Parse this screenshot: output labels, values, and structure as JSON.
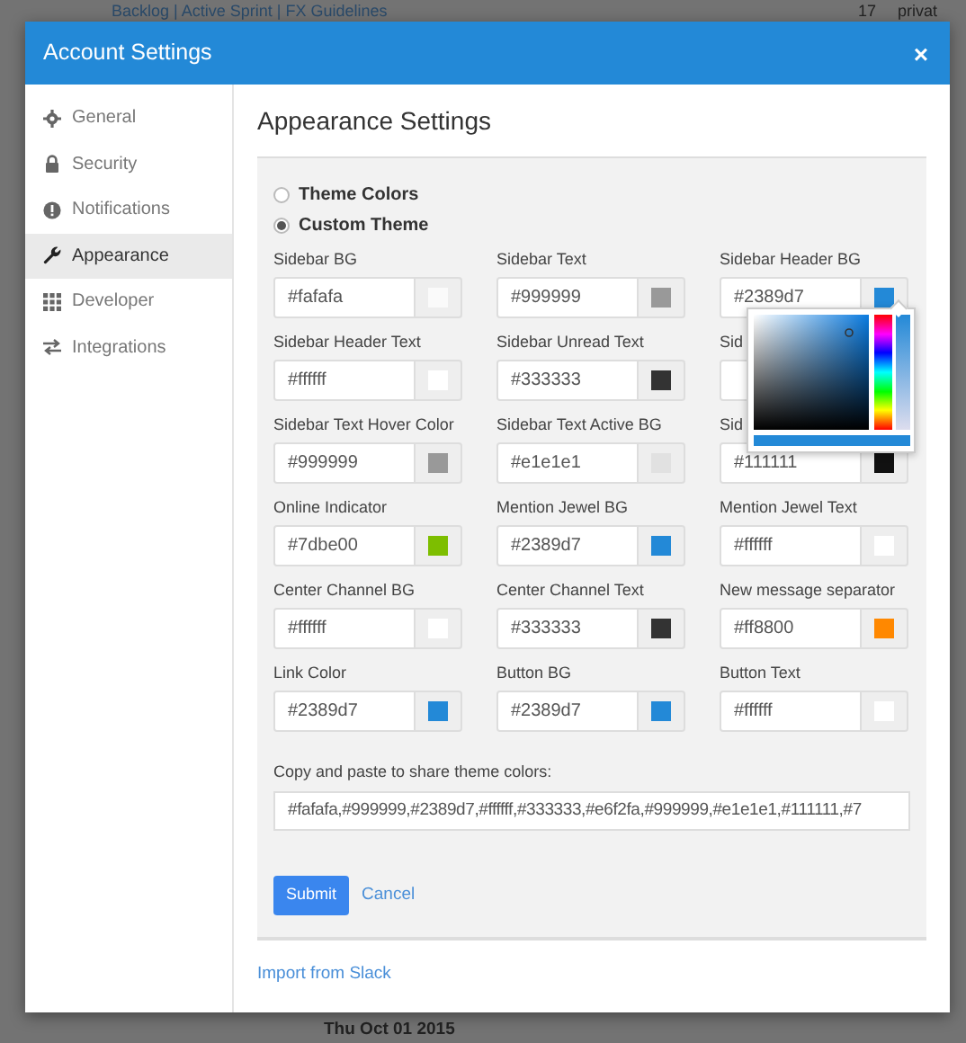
{
  "background": {
    "top_links": "Backlog | Active Sprint | FX Guidelines",
    "member_count": "17",
    "channel_name": "privat",
    "date_divider": "Thu Oct 01 2015"
  },
  "dialog": {
    "title": "Account Settings",
    "close": "×"
  },
  "sidebar": {
    "items": [
      {
        "label": "General",
        "selected": false
      },
      {
        "label": "Security",
        "selected": false
      },
      {
        "label": "Notifications",
        "selected": false
      },
      {
        "label": "Appearance",
        "selected": true
      },
      {
        "label": "Developer",
        "selected": false
      },
      {
        "label": "Integrations",
        "selected": false
      }
    ]
  },
  "content": {
    "heading": "Appearance Settings",
    "theme_options": [
      {
        "label": "Theme Colors",
        "selected": false
      },
      {
        "label": "Custom Theme",
        "selected": true
      }
    ],
    "fields": [
      {
        "label": "Sidebar BG",
        "value": "#fafafa",
        "color": "#fafafa"
      },
      {
        "label": "Sidebar Text",
        "value": "#999999",
        "color": "#999999"
      },
      {
        "label": "Sidebar Header BG",
        "value": "#2389d7",
        "color": "#2389d7"
      },
      {
        "label": "Sidebar Header Text",
        "value": "#ffffff",
        "color": "#ffffff"
      },
      {
        "label": "Sidebar Unread Text",
        "value": "#333333",
        "color": "#333333"
      },
      {
        "label": "Sid"
      },
      {
        "label": "Sidebar Text Hover Color",
        "value": "#999999",
        "color": "#999999"
      },
      {
        "label": "Sidebar Text Active BG",
        "value": "#e1e1e1",
        "color": "#e1e1e1"
      },
      {
        "label": "Sid",
        "value": "#111111",
        "color": "#111111"
      },
      {
        "label": "Online Indicator",
        "value": "#7dbe00",
        "color": "#7dbe00"
      },
      {
        "label": "Mention Jewel BG",
        "value": "#2389d7",
        "color": "#2389d7"
      },
      {
        "label": "Mention Jewel Text",
        "value": "#ffffff",
        "color": "#ffffff"
      },
      {
        "label": "Center Channel BG",
        "value": "#ffffff",
        "color": "#ffffff"
      },
      {
        "label": "Center Channel Text",
        "value": "#333333",
        "color": "#333333"
      },
      {
        "label": "New message separator",
        "value": "#ff8800",
        "color": "#ff8800"
      },
      {
        "label": "Link Color",
        "value": "#2389d7",
        "color": "#2389d7"
      },
      {
        "label": "Button BG",
        "value": "#2389d7",
        "color": "#2389d7"
      },
      {
        "label": "Button Text",
        "value": "#ffffff",
        "color": "#ffffff"
      }
    ],
    "share_label": "Copy and paste to share theme colors:",
    "share_value": "#fafafa,#999999,#2389d7,#ffffff,#333333,#e6f2fa,#999999,#e1e1e1,#111111,#7",
    "submit": "Submit",
    "cancel": "Cancel",
    "import_link": "Import from Slack"
  }
}
